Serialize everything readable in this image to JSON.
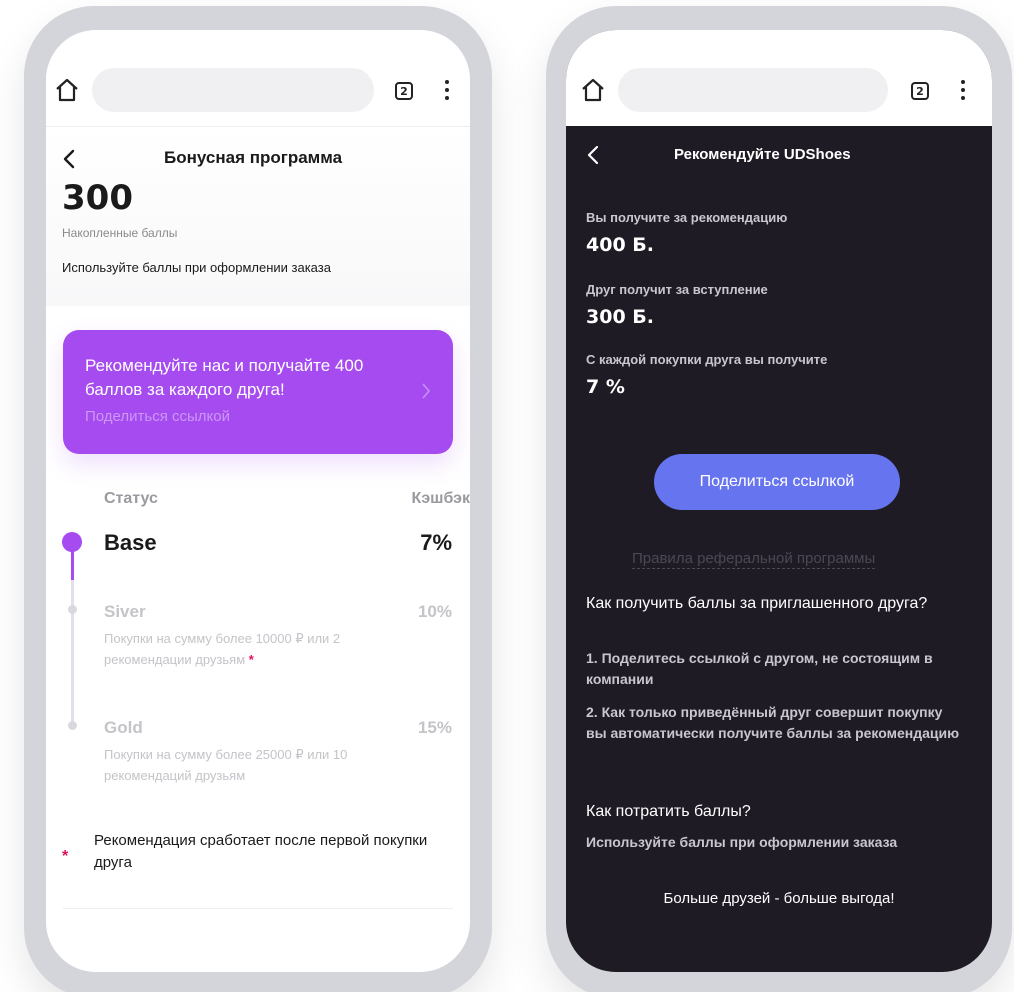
{
  "browser": {
    "tab_count_left": "2",
    "tab_count_right": "2"
  },
  "left": {
    "title": "Бонусная программа",
    "points": "300",
    "points_label": "Накопленные баллы",
    "points_hint": "Используйте баллы при оформлении заказа",
    "promo": {
      "text": "Рекомендуйте нас и получайте 400 баллов за каждого друга!",
      "link": "Поделиться ссылкой",
      "bg_color": "#a64bf0"
    },
    "columns": {
      "status": "Статус",
      "cashback": "Кэшбэк"
    },
    "tiers": [
      {
        "name": "Base",
        "cashback": "7%",
        "active": true,
        "desc": "",
        "desc_star": ""
      },
      {
        "name": "Siver",
        "cashback": "10%",
        "active": false,
        "desc": "Покупки на сумму более 10000 ₽ или 2 рекомендации друзьям",
        "desc_star": "*"
      },
      {
        "name": "Gold",
        "cashback": "15%",
        "active": false,
        "desc": "Покупки на сумму более 25000 ₽ или 10 рекомендаций друзьям",
        "desc_star": ""
      }
    ],
    "footnote_star": "*",
    "footnote": "Рекомендация сработает после первой покупки друга"
  },
  "right": {
    "title": "Рекомендуйте UDShoes",
    "you_get_label": "Вы получите за рекомендацию",
    "you_get_value": "400 Б.",
    "friend_get_label": "Друг получит за вступление",
    "friend_get_value": "300 Б.",
    "each_purchase_label": "С каждой покупки друга вы получите",
    "each_purchase_value": "7 %",
    "share_button": "Поделиться ссылкой",
    "rules_link": "Правила реферальной программы",
    "q1_title": "Как получить баллы за приглашенного друга?",
    "q1_step1": "1. Поделитесь ссылкой с другом, не состоящим в компании",
    "q1_step2": "2. Как только приведённый друг совершит покупку вы автоматически получите баллы за рекомендацию",
    "q2_title": "Как потратить баллы?",
    "q2_body": "Используйте баллы при оформлении заказа",
    "footer": "Больше друзей - больше выгода!",
    "button_color": "#6675ef",
    "bg_color": "#1f1b25"
  },
  "icons": [
    "home-icon",
    "tabs-icon",
    "more-vert-icon",
    "back-arrow-icon",
    "chevron-right-icon"
  ]
}
